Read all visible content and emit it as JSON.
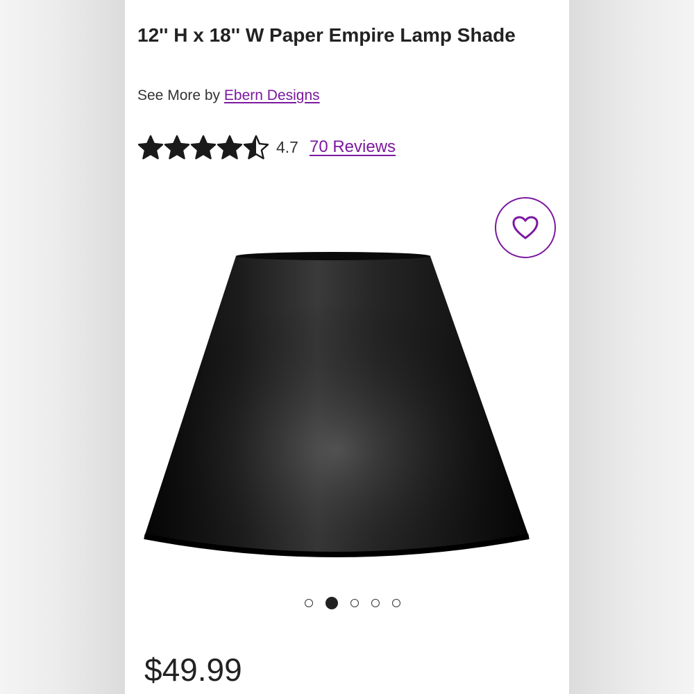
{
  "product": {
    "title": "12'' H x 18'' W Paper Empire Lamp Shade",
    "byline_prefix": "See More by",
    "brand": "Ebern Designs",
    "rating": "4.7",
    "rating_stars": 4.5,
    "reviews_label": "70 Reviews",
    "price": "$49.99"
  },
  "gallery": {
    "image_count": 5,
    "active_index": 1
  },
  "icons": {
    "star": "star-icon",
    "favorite": "heart-outline-icon"
  },
  "colors": {
    "accent": "#7b189f",
    "text": "#222222",
    "shade": "#111111"
  }
}
